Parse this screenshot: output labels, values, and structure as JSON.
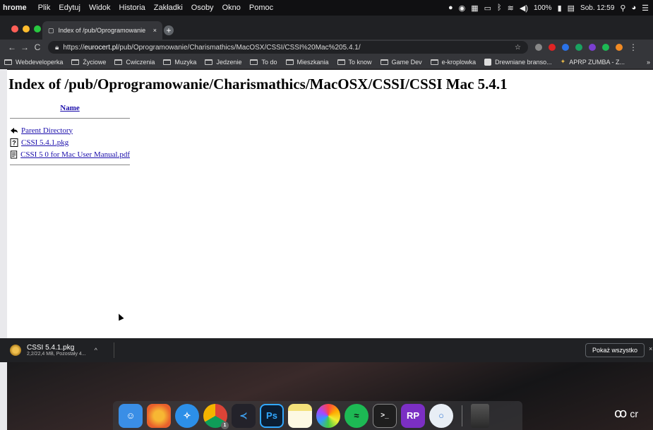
{
  "menubar": {
    "app": "hrome",
    "items": [
      "Plik",
      "Edytuj",
      "Widok",
      "Historia",
      "Zakładki",
      "Osoby",
      "Okno",
      "Pomoc"
    ],
    "battery": "100%",
    "datetime": "Sob. 12:59"
  },
  "tab": {
    "title": "Index of /pub/Oprogramowanie",
    "close_label": "×",
    "new_tab_label": "+"
  },
  "toolbar": {
    "back": "←",
    "forward": "→",
    "reload": "C",
    "url_scheme": "https://",
    "url_host": "eurocert.pl",
    "url_path": "/pub/Oprogramowanie/Charismathics/MacOSX/CSSI/CSSI%20Mac%205.4.1/",
    "bookmark_star": "☆",
    "menu_dots": "⋮"
  },
  "bookmarks": [
    "Webdeveloperka",
    "Życiowe",
    "Cwiczenia",
    "Muzyka",
    "Jedzenie",
    "To do",
    "Mieszkania",
    "To know",
    "Game Dev",
    "e-kroplowka",
    "Drewniane branso...",
    "APRP ZUMBA - Z..."
  ],
  "bookmarks_more": "»",
  "page": {
    "heading": "Index of /pub/Oprogramowanie/Charismathics/MacOSX/CSSI/CSSI Mac 5.4.1",
    "column_header": "Name",
    "entries": [
      {
        "label": "Parent Directory",
        "icon": "back-arrow-icon"
      },
      {
        "label": "CSSI 5.4.1.pkg",
        "icon": "unknown-file-icon"
      },
      {
        "label": "CSSI 5 0 for Mac User Manual.pdf",
        "icon": "document-icon"
      }
    ]
  },
  "download": {
    "filename": "CSSI 5.4.1.pkg",
    "status": "2,2/22,4 MB, Pozostały 4...",
    "chevron": "^",
    "show_all": "Pokaż wszystko",
    "close": "×"
  },
  "dock": {
    "apps": [
      {
        "name": "finder-icon",
        "color": "#3a8ee6"
      },
      {
        "name": "firefox-icon",
        "color": "#e8602c"
      },
      {
        "name": "safari-icon",
        "color": "#2c8fe8"
      },
      {
        "name": "chrome-icon",
        "color": "#dcdcdc"
      },
      {
        "name": "vscode-icon",
        "color": "#23222a"
      },
      {
        "name": "photoshop-icon",
        "color": "#0a1d33"
      },
      {
        "name": "notes-icon",
        "color": "#f3e17a"
      },
      {
        "name": "photos-icon",
        "color": "#f5f5f5"
      },
      {
        "name": "spotify-icon",
        "color": "#1db954"
      },
      {
        "name": "terminal-icon",
        "color": "#1e1e1e"
      },
      {
        "name": "rapidweaver-icon",
        "color": "#7b2fc4"
      },
      {
        "name": "proxyman-icon",
        "color": "#e8eef5"
      },
      {
        "name": "trash-icon",
        "color": "#3a3a3a"
      }
    ],
    "ps_label": "Ps",
    "rp_label": "RP",
    "chrome_badge": "1"
  },
  "colors": {
    "link": "#1a0dab",
    "chrome_dark": "#202124",
    "traffic_red": "#ff5f57",
    "traffic_yellow": "#febc2e",
    "traffic_green": "#28c840"
  }
}
